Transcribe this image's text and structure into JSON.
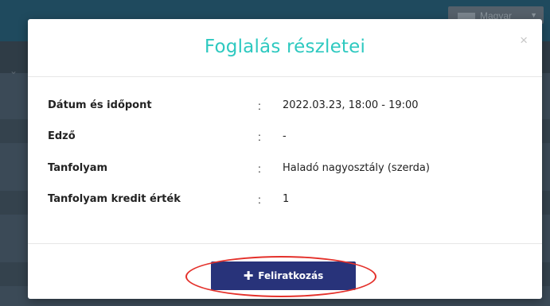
{
  "background": {
    "language_selector": "Magyar"
  },
  "modal": {
    "title": "Foglalás részletei",
    "close_symbol": "×",
    "details": [
      {
        "label": "Dátum és időpont",
        "separator": ":",
        "value": "2022.03.23, 18:00 - 19:00"
      },
      {
        "label": "Edző",
        "separator": ":",
        "value": "-"
      },
      {
        "label": "Tanfolyam",
        "separator": ":",
        "value": "Haladó nagyosztály (szerda)"
      },
      {
        "label": "Tanfolyam kredit érték",
        "separator": ":",
        "value": "1"
      }
    ],
    "subscribe_button": {
      "icon": "plus-icon",
      "label": "Feliratkozás"
    }
  },
  "colors": {
    "title": "#2ec9c0",
    "button": "#28337a",
    "highlight": "#e4312b"
  }
}
